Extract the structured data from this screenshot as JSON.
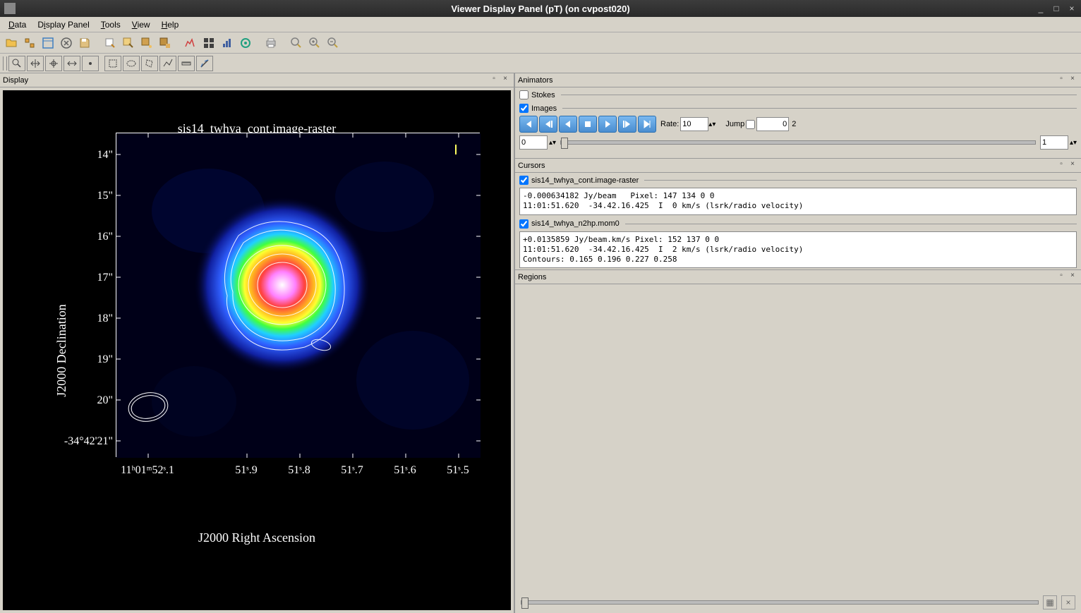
{
  "window": {
    "title": "Viewer Display Panel (pT) (on cvpost020)"
  },
  "menubar": {
    "data": "Data",
    "display_panel": "Display Panel",
    "tools": "Tools",
    "view": "View",
    "help": "Help"
  },
  "panels": {
    "display": "Display",
    "animators": "Animators",
    "cursors": "Cursors",
    "regions": "Regions"
  },
  "animators": {
    "stokes": "Stokes",
    "images": "Images",
    "rate_label": "Rate:",
    "rate_value": "10",
    "jump_label": "Jump",
    "jump_value": "0",
    "jump_max": "2",
    "frame_start": "0",
    "frame_end": "1"
  },
  "cursors": {
    "item1_label": "sis14_twhya_cont.image-raster",
    "item1_data": "-0.000634182 Jy/beam   Pixel: 147 134 0 0\n11:01:51.620  -34.42.16.425  I  0 km/s (lsrk/radio velocity)",
    "item2_label": "sis14_twhya_n2hp.mom0",
    "item2_data": "+0.0135859 Jy/beam.km/s Pixel: 152 137 0 0\n11:01:51.620  -34.42.16.425  I  2 km/s (lsrk/radio velocity)\nContours: 0.165 0.196 0.227 0.258"
  },
  "plot": {
    "title": "sis14_twhya_cont.image-raster",
    "ylabel": "J2000 Declination",
    "xlabel": "J2000 Right Ascension",
    "yticks": [
      "14\"",
      "15\"",
      "16\"",
      "17\"",
      "18\"",
      "19\"",
      "20\"",
      "-34°42'21\""
    ],
    "xticks": [
      "11ʰ01ᵐ52ˢ.1",
      "51ˢ.9",
      "51ˢ.8",
      "51ˢ.7",
      "51ˢ.6",
      "51ˢ.5"
    ]
  }
}
